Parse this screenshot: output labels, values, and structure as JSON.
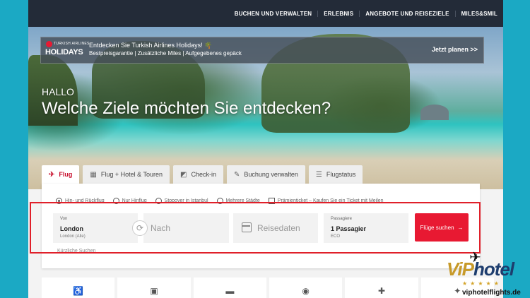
{
  "nav": {
    "items": [
      "BUCHEN UND VERWALTEN",
      "ERLEBNIS",
      "ANGEBOTE UND REISEZIELE",
      "MILES&SMIL"
    ]
  },
  "promo": {
    "logo_small": "TURKISH AIRLINES",
    "logo_big": "HOLIDAYS",
    "title": "Entdecken Sie Turkish Airlines Holidays! 🌴",
    "subtitle": "Bestpreisgarantie | Zusätzliche Miles | Aufgegebenes gepäck",
    "cta": "Jetzt planen >>"
  },
  "hero": {
    "greeting": "HALLO",
    "headline": "Welche Ziele möchten Sie entdecken?"
  },
  "tabs": [
    {
      "label": "Flug",
      "icon": "plane-icon",
      "active": true
    },
    {
      "label": "Flug + Hotel & Touren",
      "icon": "hotel-icon",
      "active": false
    },
    {
      "label": "Check-in",
      "icon": "checkin-icon",
      "active": false
    },
    {
      "label": "Buchung verwalten",
      "icon": "manage-icon",
      "active": false
    },
    {
      "label": "Flugstatus",
      "icon": "status-icon",
      "active": false
    }
  ],
  "trip_options": [
    {
      "label": "Hin- und Rückflug",
      "selected": true
    },
    {
      "label": "Nur Hinflug",
      "selected": false
    },
    {
      "label": "Stopover in Istanbul",
      "selected": false
    },
    {
      "label": "Mehrere Städte",
      "selected": false
    }
  ],
  "award_ticket": "Prämienticket – Kaufen Sie ein Ticket mit Meilen",
  "search": {
    "from_label": "Von",
    "from_value": "London",
    "from_detail": "London (Alle)",
    "to_placeholder": "Nach",
    "date_placeholder": "Reisedaten",
    "pax_label": "Passagiere",
    "pax_value": "1 Passagier",
    "pax_class": "ECO",
    "button": "Flüge suchen",
    "recent": "Kürzliche Suchen"
  },
  "watermark": {
    "brand_vip": "ViP",
    "brand_hotel": "hotel",
    "stars": "★★★★★",
    "url": "viphotelflights.de"
  },
  "colors": {
    "accent": "#e81932",
    "nav_bg": "#232b38",
    "highlight": "#e0202a"
  }
}
